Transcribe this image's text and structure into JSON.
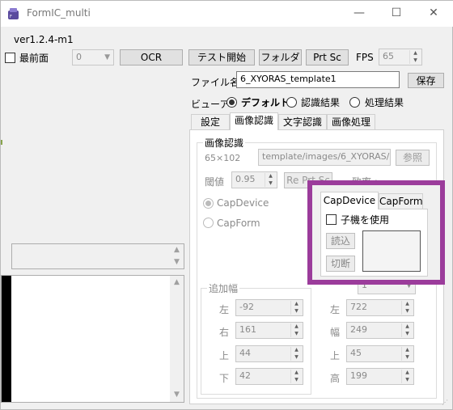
{
  "window": {
    "title": "FormIC_multi",
    "minimize": "—",
    "maximize": "☐",
    "close": "✕"
  },
  "version": "ver1.2.4-m1",
  "toolbar": {
    "topmost_label": "最前面",
    "combo_value": "0",
    "ocr": "OCR",
    "test_start": "テスト開始",
    "folder": "フォルダ",
    "prtsc": "Prt Sc",
    "fps_label": "FPS",
    "fps_value": "65"
  },
  "file": {
    "label": "ファイル名",
    "value": "6_XYORAS_template1",
    "save": "保存"
  },
  "viewer": {
    "label": "ビューア",
    "options": [
      "デフォルト",
      "認識結果",
      "処理結果"
    ],
    "selected": "デフォルト"
  },
  "tabs": [
    "設定",
    "画像認識",
    "文字認識",
    "画像処理"
  ],
  "image_recog": {
    "group_label": "画像認識",
    "size": "65×102",
    "path": "template/images/6_XYORAS/6",
    "browse": "参照",
    "threshold_label": "閾値",
    "threshold_value": "0.95",
    "reprtsc": "Re Prt Sc",
    "hidden_label": "致率 :",
    "cap_device": "CapDevice",
    "cap_form": "CapForm"
  },
  "add_width": {
    "label": "追加幅",
    "left_label": "左",
    "left": "-92",
    "right_label": "右",
    "right": "161",
    "top_label": "上",
    "top": "44",
    "bottom_label": "下",
    "bottom": "42"
  },
  "pos": {
    "left_label": "左",
    "left": "722",
    "width_label": "幅",
    "width": "249",
    "top_label": "上",
    "top": "45",
    "height_label": "高",
    "height": "199",
    "combo": "1"
  },
  "popup": {
    "tabs": [
      "CapDevice",
      "CapForm"
    ],
    "child_label": "子機を使用",
    "read": "読込",
    "disconnect": "切断"
  },
  "colors": {
    "highlight": "#9b3c9b"
  }
}
